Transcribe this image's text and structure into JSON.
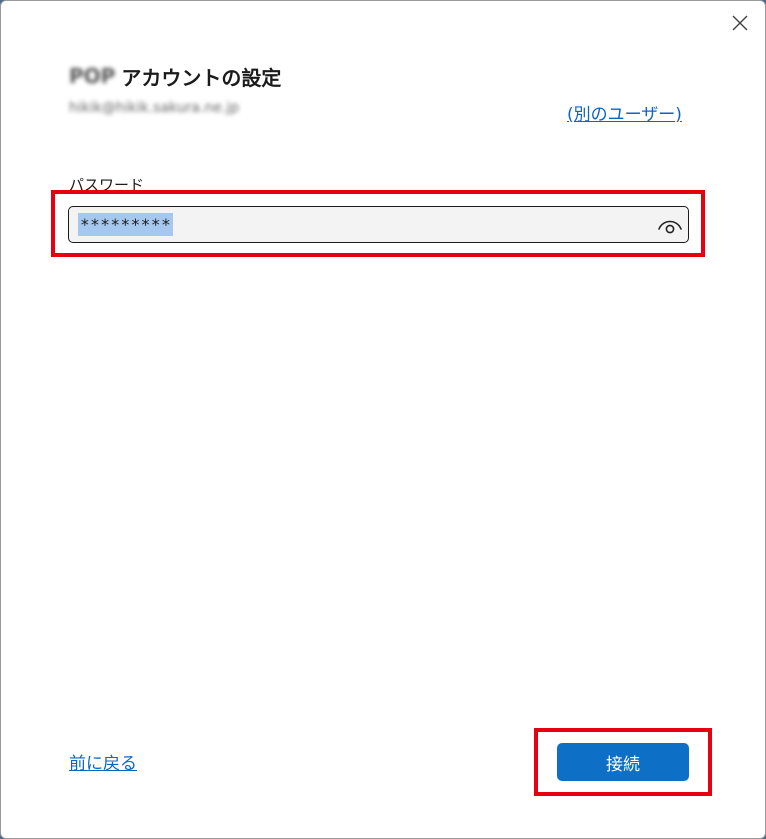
{
  "dialog": {
    "title_prefix": "POP",
    "title": "アカウントの設定",
    "email": "hikik@hikik.sakura.ne.jp",
    "switch_user_link": "(別のユーザー)",
    "close_icon": "close-icon"
  },
  "password": {
    "label": "パスワード",
    "value": "*********",
    "reveal_icon": "eye-icon"
  },
  "footer": {
    "back_link": "前に戻る",
    "connect_button": "接続"
  },
  "colors": {
    "accent": "#0e6fc6",
    "link": "#0b66c2",
    "highlight_annotation": "#e60012",
    "selection": "#a6c8ef"
  }
}
